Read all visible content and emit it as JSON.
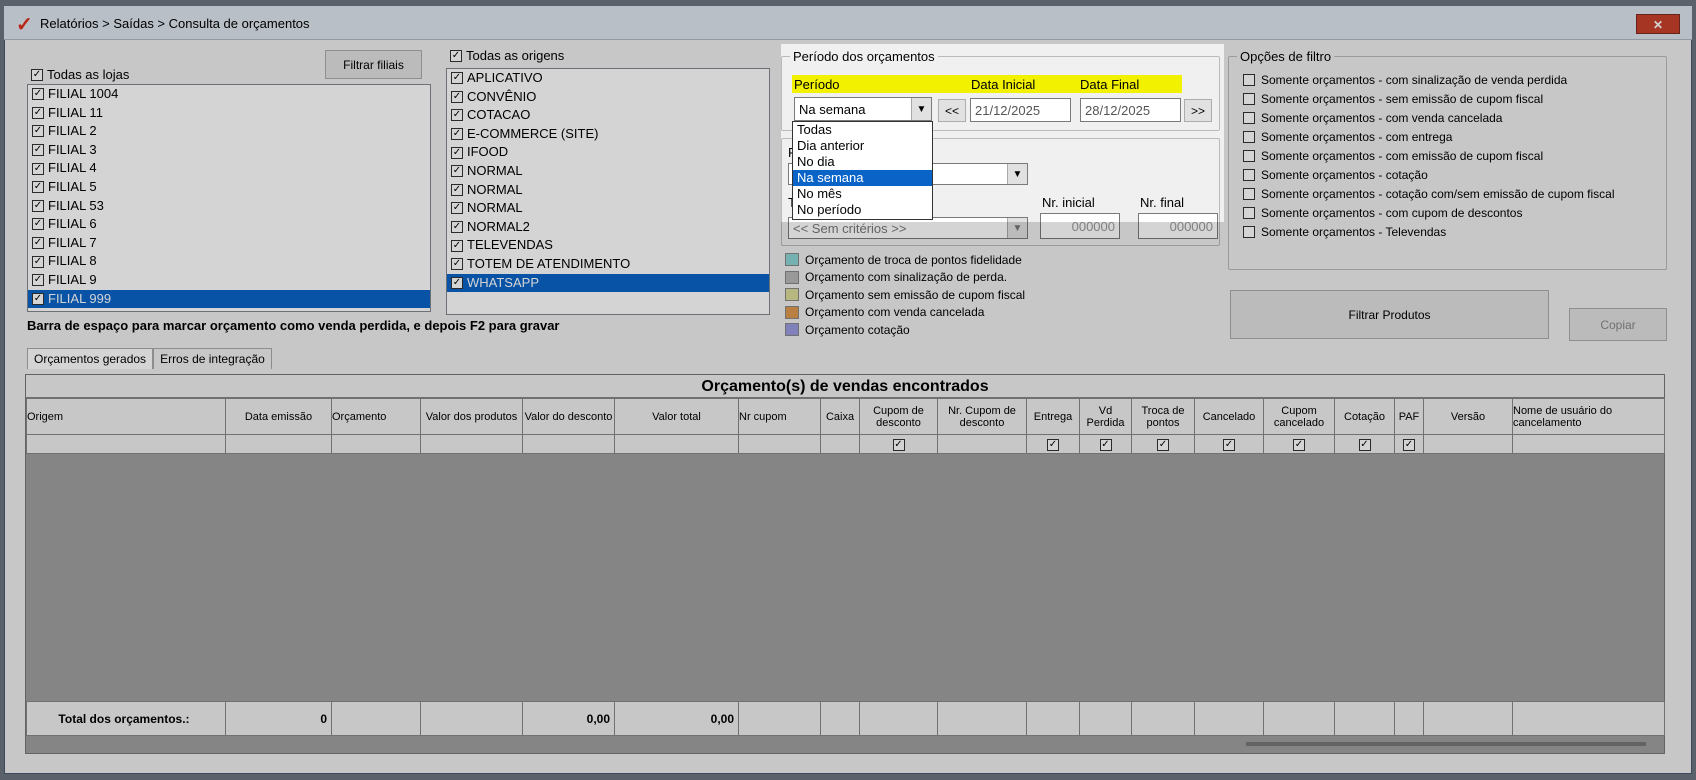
{
  "window": {
    "title": "Relatórios > Saídas > Consulta de orçamentos",
    "close_label": "✕"
  },
  "stores": {
    "all_label": "Todas as lojas",
    "filter_button": "Filtrar filiais",
    "items": [
      "FILIAL 1004",
      "FILIAL 11",
      "FILIAL 2",
      "FILIAL 3",
      "FILIAL 4",
      "FILIAL 5",
      "FILIAL 53",
      "FILIAL 6",
      "FILIAL 7",
      "FILIAL 8",
      "FILIAL 9",
      "FILIAL 999"
    ],
    "selected": "FILIAL 999"
  },
  "origins": {
    "all_label": "Todas as origens",
    "items": [
      "APLICATIVO",
      "CONVÊNIO",
      "COTACAO",
      "E-COMMERCE (SITE)",
      "IFOOD",
      "NORMAL",
      "NORMAL",
      "NORMAL",
      "NORMAL2",
      "TELEVENDAS",
      "TOTEM DE ATENDIMENTO",
      "WHATSAPP"
    ],
    "selected": "WHATSAPP"
  },
  "period": {
    "group_label": "Período dos orçamentos",
    "period_label": "Período",
    "start_label": "Data Inicial",
    "end_label": "Data Final",
    "selected": "Na semana",
    "prev": "<<",
    "next": ">>",
    "start": "21/12/2025",
    "end": "28/12/2025",
    "options": [
      "Todas",
      "Dia anterior",
      "No dia",
      "Na semana",
      "No mês",
      "No período"
    ]
  },
  "criteria": {
    "group_letter": "P",
    "type_letter": "T",
    "criteria_value": "<< Sem critérios >>",
    "nr_start_label": "Nr. inicial",
    "nr_end_label": "Nr. final",
    "nr_start": "000000",
    "nr_end": "000000"
  },
  "legend": [
    {
      "label": "Orçamento de troca de pontos fidelidade",
      "color": "#8fd6d6"
    },
    {
      "label": "Orçamento com sinalização de perda.",
      "color": "#b8b8b8"
    },
    {
      "label": "Orçamento sem emissão de cupom fiscal",
      "color": "#dcdc9a"
    },
    {
      "label": "Orçamento com venda cancelada",
      "color": "#e09a50"
    },
    {
      "label": "Orçamento cotação",
      "color": "#9a9ae0"
    }
  ],
  "filters": {
    "group_label": "Opções de filtro",
    "items": [
      "Somente orçamentos - com sinalização de venda perdida",
      "Somente orçamentos - sem emissão de cupom fiscal",
      "Somente orçamentos - com venda cancelada",
      "Somente orçamentos - com entrega",
      "Somente orçamentos - com emissão de cupom fiscal",
      "Somente orçamentos - cotação",
      "Somente orçamentos - cotação com/sem emissão de cupom fiscal",
      "Somente orçamentos - com cupom de descontos",
      "Somente orçamentos - Televendas"
    ]
  },
  "buttons": {
    "filter_products": "Filtrar Produtos",
    "copy": "Copiar"
  },
  "hint": "Barra de espaço para marcar orçamento como venda perdida, e depois F2 para gravar",
  "tabs": [
    "Orçamentos gerados",
    "Erros de integração"
  ],
  "grid": {
    "title": "Orçamento(s) de vendas encontrados",
    "columns": [
      "Origem",
      "Data emissão",
      "Orçamento",
      "Valor dos produtos",
      "Valor do desconto",
      "Valor total",
      "Nr cupom",
      "Caixa",
      "Cupom de desconto",
      "Nr. Cupom de desconto",
      "Entrega",
      "Vd Perdida",
      "Troca de pontos",
      "Cancelado",
      "Cupom cancelado",
      "Cotação",
      "PAF",
      "Versão",
      "Nome de usuário do cancelamento"
    ],
    "checkbox_columns": [
      8,
      10,
      11,
      12,
      13,
      14,
      15,
      16
    ],
    "totals": [
      "Total dos orçamentos.:",
      "0",
      "",
      "",
      "0,00",
      "0,00",
      "",
      "",
      "",
      "",
      "",
      "",
      "",
      "",
      "",
      "",
      "",
      "",
      ""
    ]
  }
}
